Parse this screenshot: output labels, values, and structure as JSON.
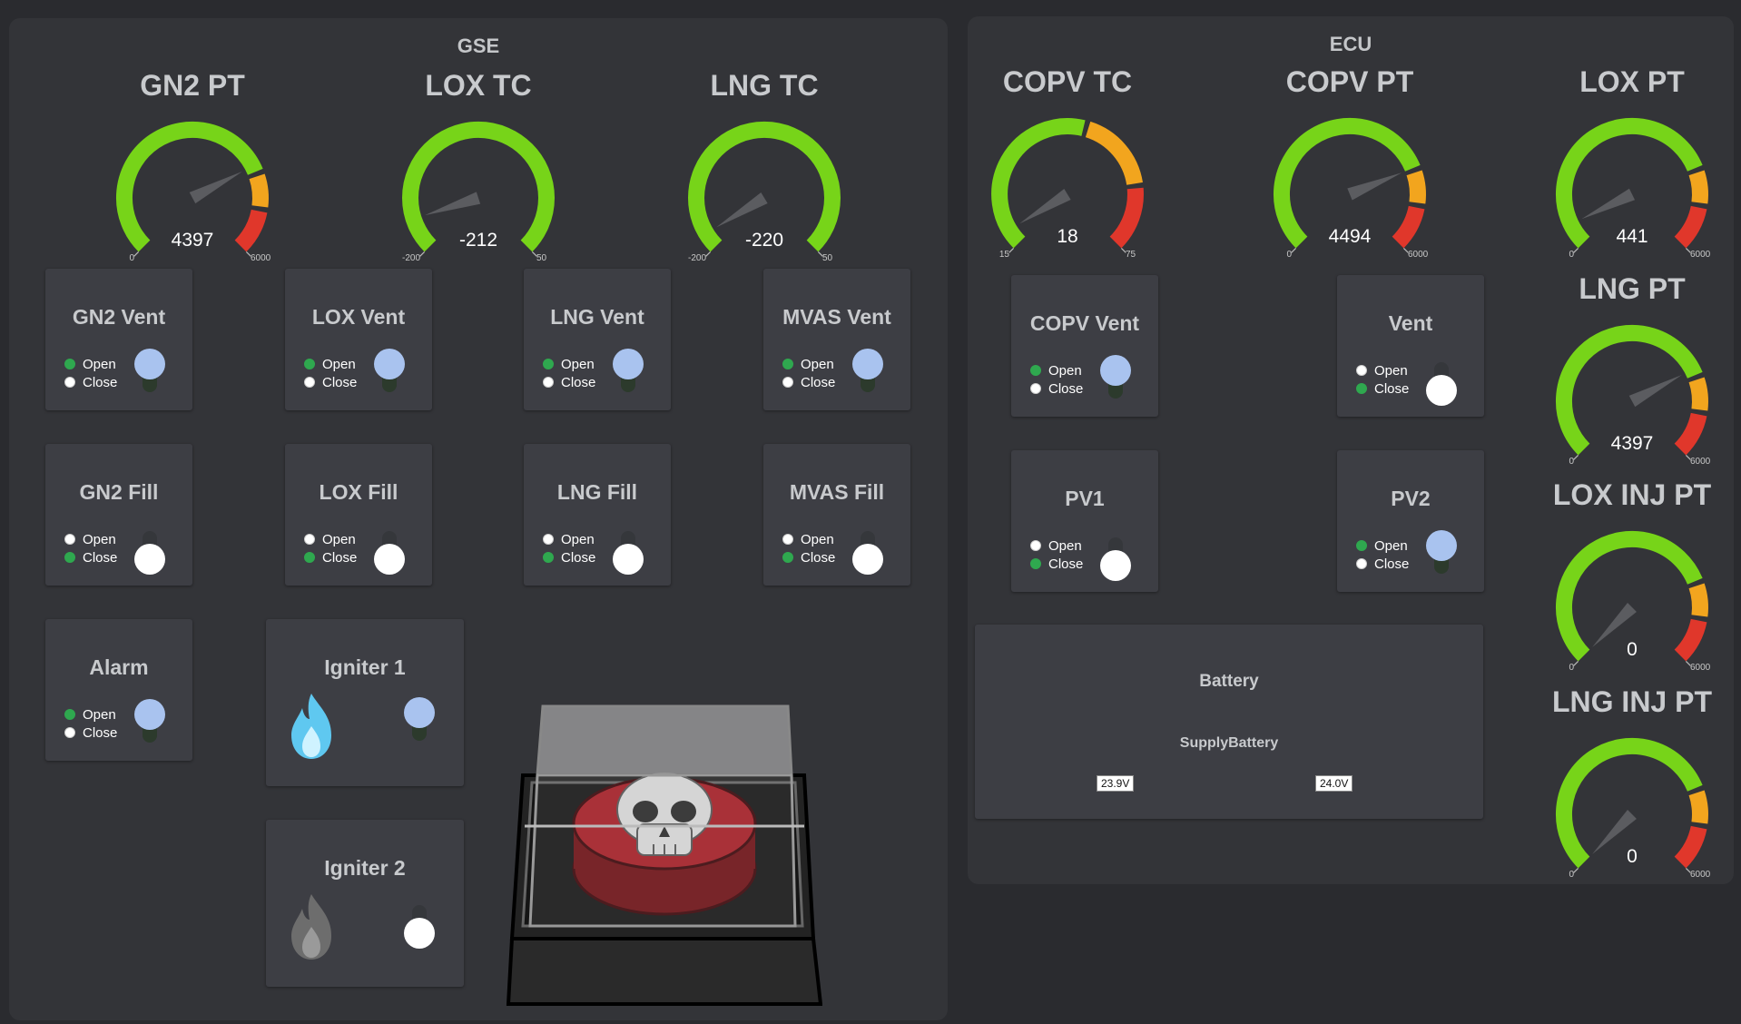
{
  "gse": {
    "title": "GSE",
    "gauges": [
      {
        "title": "GN2 PT",
        "value": "4397",
        "min": "0",
        "max": "6000",
        "needle": 0.73,
        "zones": "pressure"
      },
      {
        "title": "LOX TC",
        "value": "-212",
        "min": "-200",
        "max": "50",
        "needle": 0.1,
        "zones": "temp"
      },
      {
        "title": "LNG TC",
        "value": "-220",
        "min": "-200",
        "max": "50",
        "needle": 0.05,
        "zones": "temp"
      }
    ],
    "valves": [
      {
        "label": "GN2 Vent",
        "state": "open"
      },
      {
        "label": "LOX Vent",
        "state": "open"
      },
      {
        "label": "LNG Vent",
        "state": "open"
      },
      {
        "label": "MVAS Vent",
        "state": "open"
      },
      {
        "label": "GN2 Fill",
        "state": "closed"
      },
      {
        "label": "LOX Fill",
        "state": "closed"
      },
      {
        "label": "LNG Fill",
        "state": "closed"
      },
      {
        "label": "MVAS Fill",
        "state": "closed"
      },
      {
        "label": "Alarm",
        "state": "open"
      }
    ],
    "igniters": [
      {
        "label": "Igniter 1",
        "state": "open"
      },
      {
        "label": "Igniter 2",
        "state": "closed"
      }
    ]
  },
  "ecu": {
    "title": "ECU",
    "gauges": [
      {
        "title": "COPV TC",
        "value": "18",
        "min": "15",
        "max": "75",
        "needle": 0.05,
        "zones": "copv"
      },
      {
        "title": "COPV PT",
        "value": "4494",
        "min": "0",
        "max": "6000",
        "needle": 0.75,
        "zones": "pressure"
      },
      {
        "title": "LOX PT",
        "value": "441",
        "min": "0",
        "max": "6000",
        "needle": 0.07,
        "zones": "pressure"
      },
      {
        "title": "LNG PT",
        "value": "4397",
        "min": "0",
        "max": "6000",
        "needle": 0.73,
        "zones": "pressure"
      },
      {
        "title": "LOX INJ PT",
        "value": "0",
        "min": "0",
        "max": "6000",
        "needle": 0,
        "zones": "pressure"
      },
      {
        "title": "LNG INJ PT",
        "value": "0",
        "min": "0",
        "max": "6000",
        "needle": 0,
        "zones": "pressure"
      }
    ],
    "valves": [
      {
        "label": "COPV Vent",
        "state": "open"
      },
      {
        "label": "Vent",
        "state": "closed"
      },
      {
        "label": "PV1",
        "state": "closed"
      },
      {
        "label": "PV2",
        "state": "open"
      }
    ],
    "battery": {
      "title": "Battery",
      "subtitle": "SupplyBattery",
      "voltage_1": "23.9V",
      "voltage_2": "24.0V"
    }
  },
  "labels": {
    "open": "Open",
    "close": "Close"
  },
  "colors": {
    "green": "#77d419",
    "orange": "#f2a51e",
    "red": "#e0372b",
    "indicator_on": "#2fa84f",
    "knob_open": "#a9c3ef"
  },
  "icons": {
    "igniter_1": "flame-icon-blue",
    "igniter_2": "flame-icon-gray",
    "abort": "skull-icon"
  }
}
